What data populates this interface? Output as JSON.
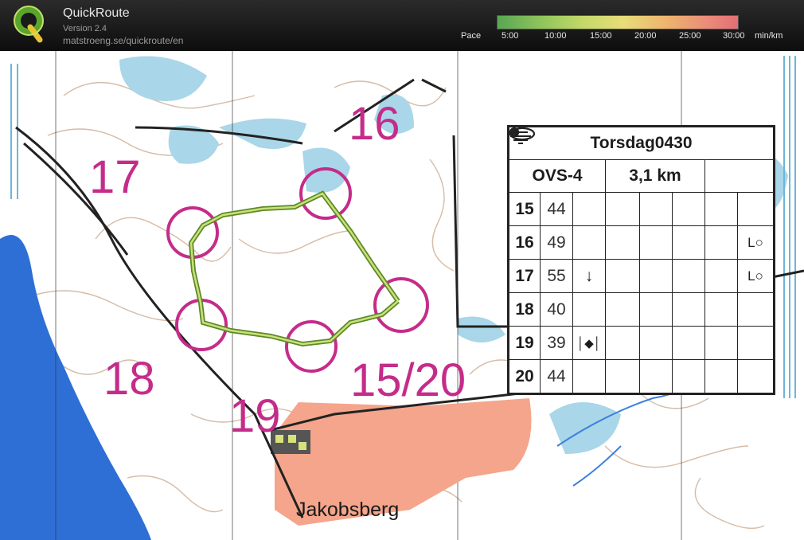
{
  "header": {
    "app_name": "QuickRoute",
    "version": "Version 2.4",
    "url": "matstroeng.se/quickroute/en",
    "pace_label": "Pace",
    "pace_ticks": [
      "5:00",
      "10:00",
      "15:00",
      "20:00",
      "25:00",
      "30:00"
    ],
    "pace_unit": "min/km",
    "logo_icon": "quickroute-logo-icon"
  },
  "map": {
    "control_numbers": [
      "16",
      "17",
      "18",
      "19",
      "15/20"
    ],
    "place_label": "Jakobsberg",
    "colors": {
      "course": "#c52c8a",
      "route": "#8db83a",
      "water": "#2e6fd6",
      "marsh": "#6fb6d8",
      "building": "#f4a58b",
      "contour": "#b98a6a"
    }
  },
  "description": {
    "title": "Torsdag0430",
    "course": "OVS-4",
    "length": "3,1 km",
    "rows": [
      {
        "num": "15",
        "code": "44",
        "dir": "",
        "feature": "oval"
      },
      {
        "num": "16",
        "code": "49",
        "dir": "",
        "feature": "dot",
        "loc": "L○"
      },
      {
        "num": "17",
        "code": "55",
        "dir": "↓",
        "feature": "dot",
        "loc": "L○"
      },
      {
        "num": "18",
        "code": "40",
        "dir": "",
        "feature": "marsh"
      },
      {
        "num": "19",
        "code": "39",
        "dir": "│◆│",
        "feature": "dot"
      },
      {
        "num": "20",
        "code": "44",
        "dir": "",
        "feature": "oval"
      }
    ]
  }
}
